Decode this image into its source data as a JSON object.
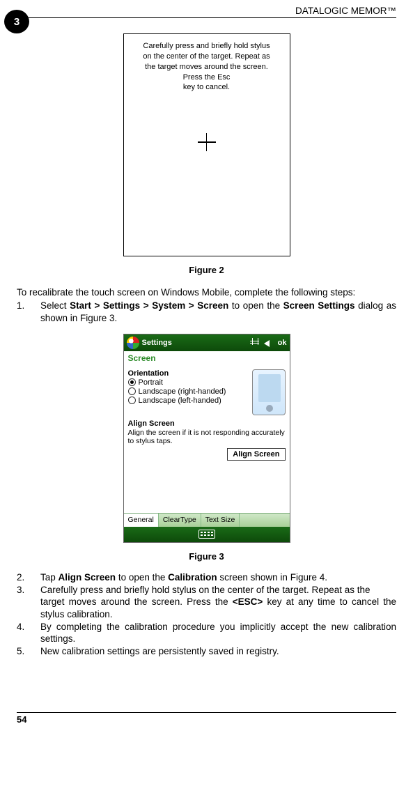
{
  "header": {
    "title": "DATALOGIC MEMOR™"
  },
  "tab_badge": "3",
  "calibration_screen": {
    "line1": "Carefully press and briefly hold stylus",
    "line2": "on the center of the target. Repeat as",
    "line3": "the target moves around the screen.",
    "line4": "Press the Esc",
    "line5": "key to cancel."
  },
  "figure2_caption": "Figure 2",
  "intro_text": "To recalibrate the touch screen on Windows Mobile, complete the following steps:",
  "step1_pre": "Select ",
  "step1_bold1": "Start > Settings > System > Screen",
  "step1_mid": " to open the ",
  "step1_bold2": "Screen Settings",
  "step1_post": " dialog as shown in Figure 3.",
  "wm": {
    "title": "Settings",
    "ok": "ok",
    "subtitle": "Screen",
    "orientation_label": "Orientation",
    "radios": [
      "Portrait",
      "Landscape (right-handed)",
      "Landscape (left-handed)"
    ],
    "align_heading": "Align Screen",
    "align_text": "Align the screen if it is not responding accurately to stylus taps.",
    "align_button": "Align Screen",
    "tabs": [
      "General",
      "ClearType",
      "Text Size"
    ]
  },
  "figure3_caption": "Figure 3",
  "step2_pre": "Tap ",
  "step2_bold1": "Align Screen",
  "step2_mid": " to open the ",
  "step2_bold2": "Calibration",
  "step2_post": " screen shown in Figure 4.",
  "step3_line1": "Carefully press and briefly hold stylus on the center of the target. Repeat as the",
  "step3_pre": "target moves around the screen. Press the ",
  "step3_bold": "<ESC>",
  "step3_post": " key at any time to cancel the stylus calibration.",
  "step4": "By completing the calibration procedure you implicitly accept the new calibration settings.",
  "step5": "New calibration settings are persistently saved in registry.",
  "page_number": "54"
}
